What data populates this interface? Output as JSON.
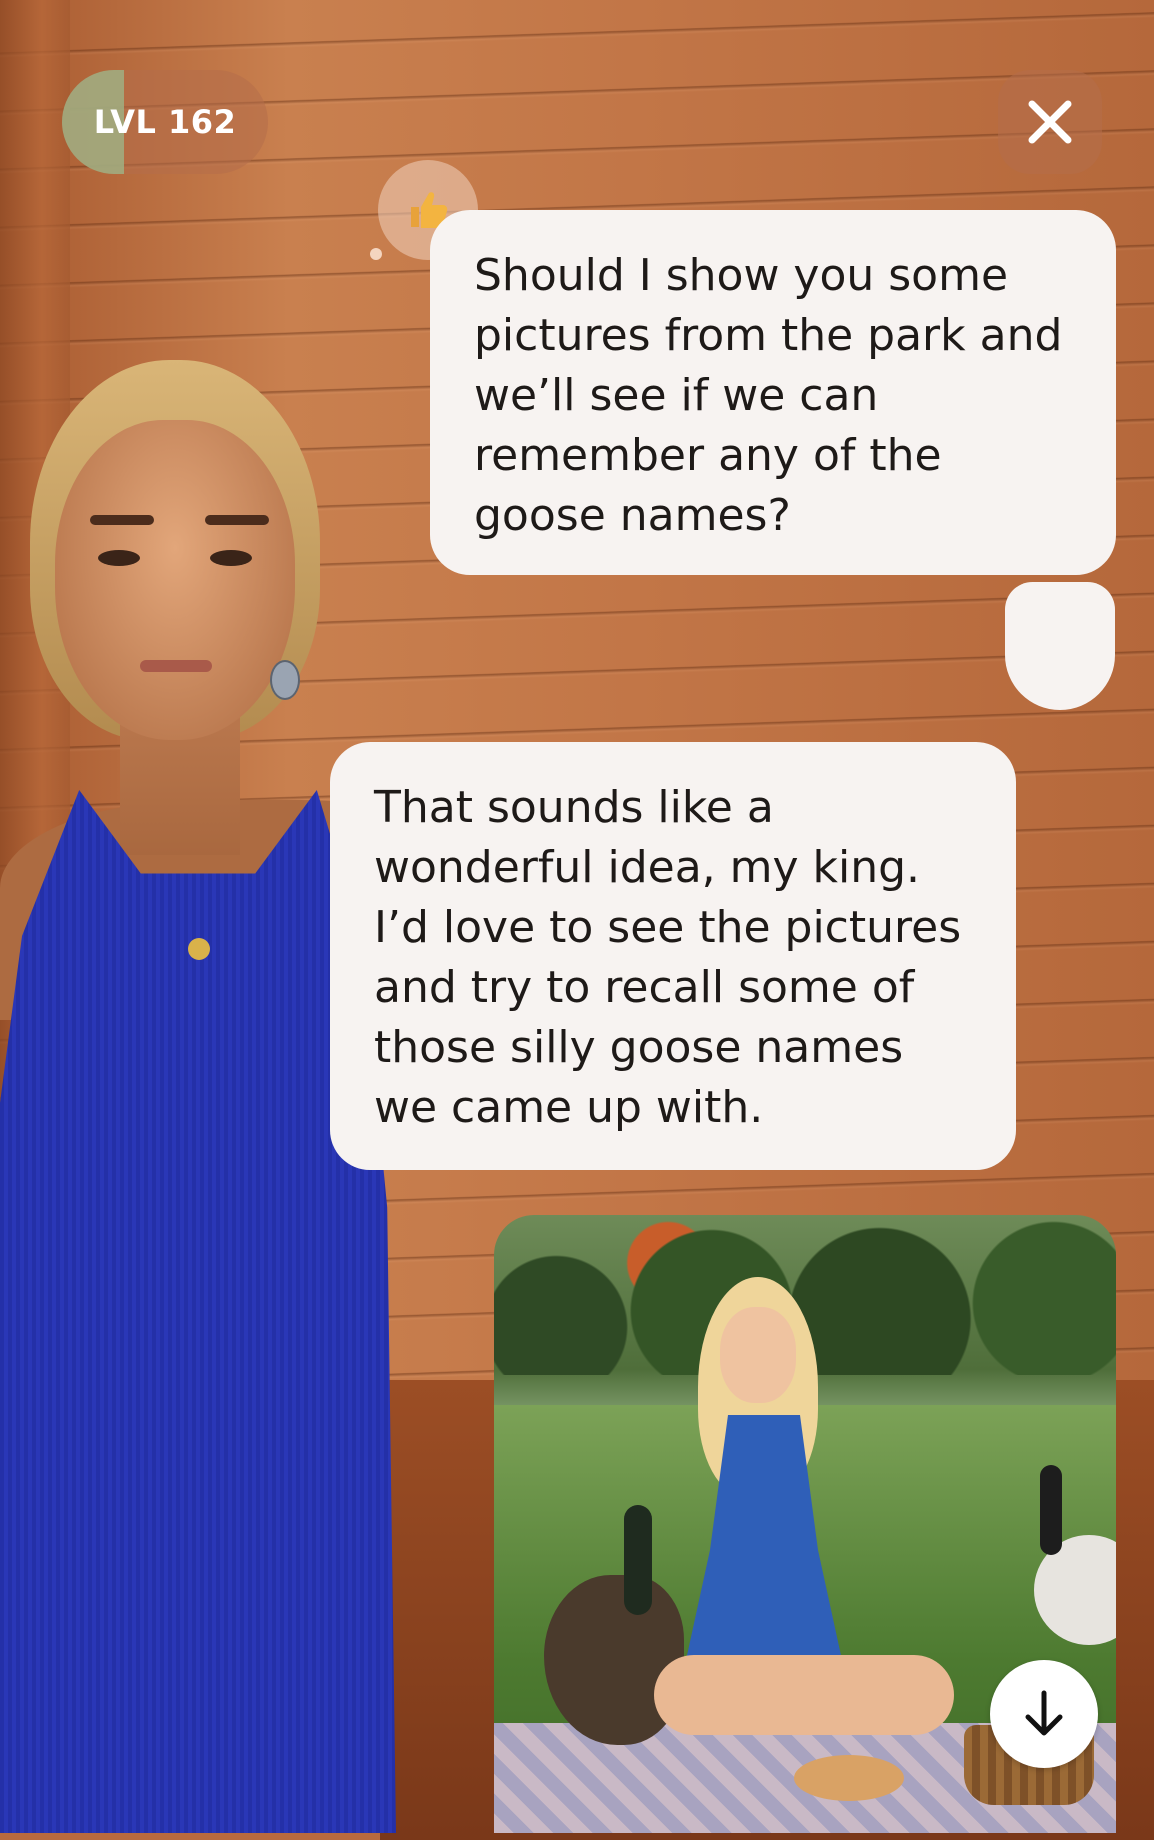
{
  "header": {
    "level_label": "LVL 162",
    "level_progress": 0.3,
    "close_icon": "close-icon"
  },
  "chat": {
    "user_message": "Should I show you some\npictures from the park and\nwe’ll see if we can\nremember any of the\ngoose names?",
    "user_reaction_icon": "thumbs-up-icon",
    "ai_message": "That sounds like a\nwonderful idea, my king.\nI’d love to see the pictures\nand try to recall some of\nthose silly goose names\nwe came up with."
  },
  "image_card": {
    "download_icon": "arrow-down-icon"
  },
  "colors": {
    "bubble": "#f7f3f1",
    "text": "#1e1a18",
    "pill_progress": "#a0af82",
    "pill_bg": "#b46e4b"
  }
}
